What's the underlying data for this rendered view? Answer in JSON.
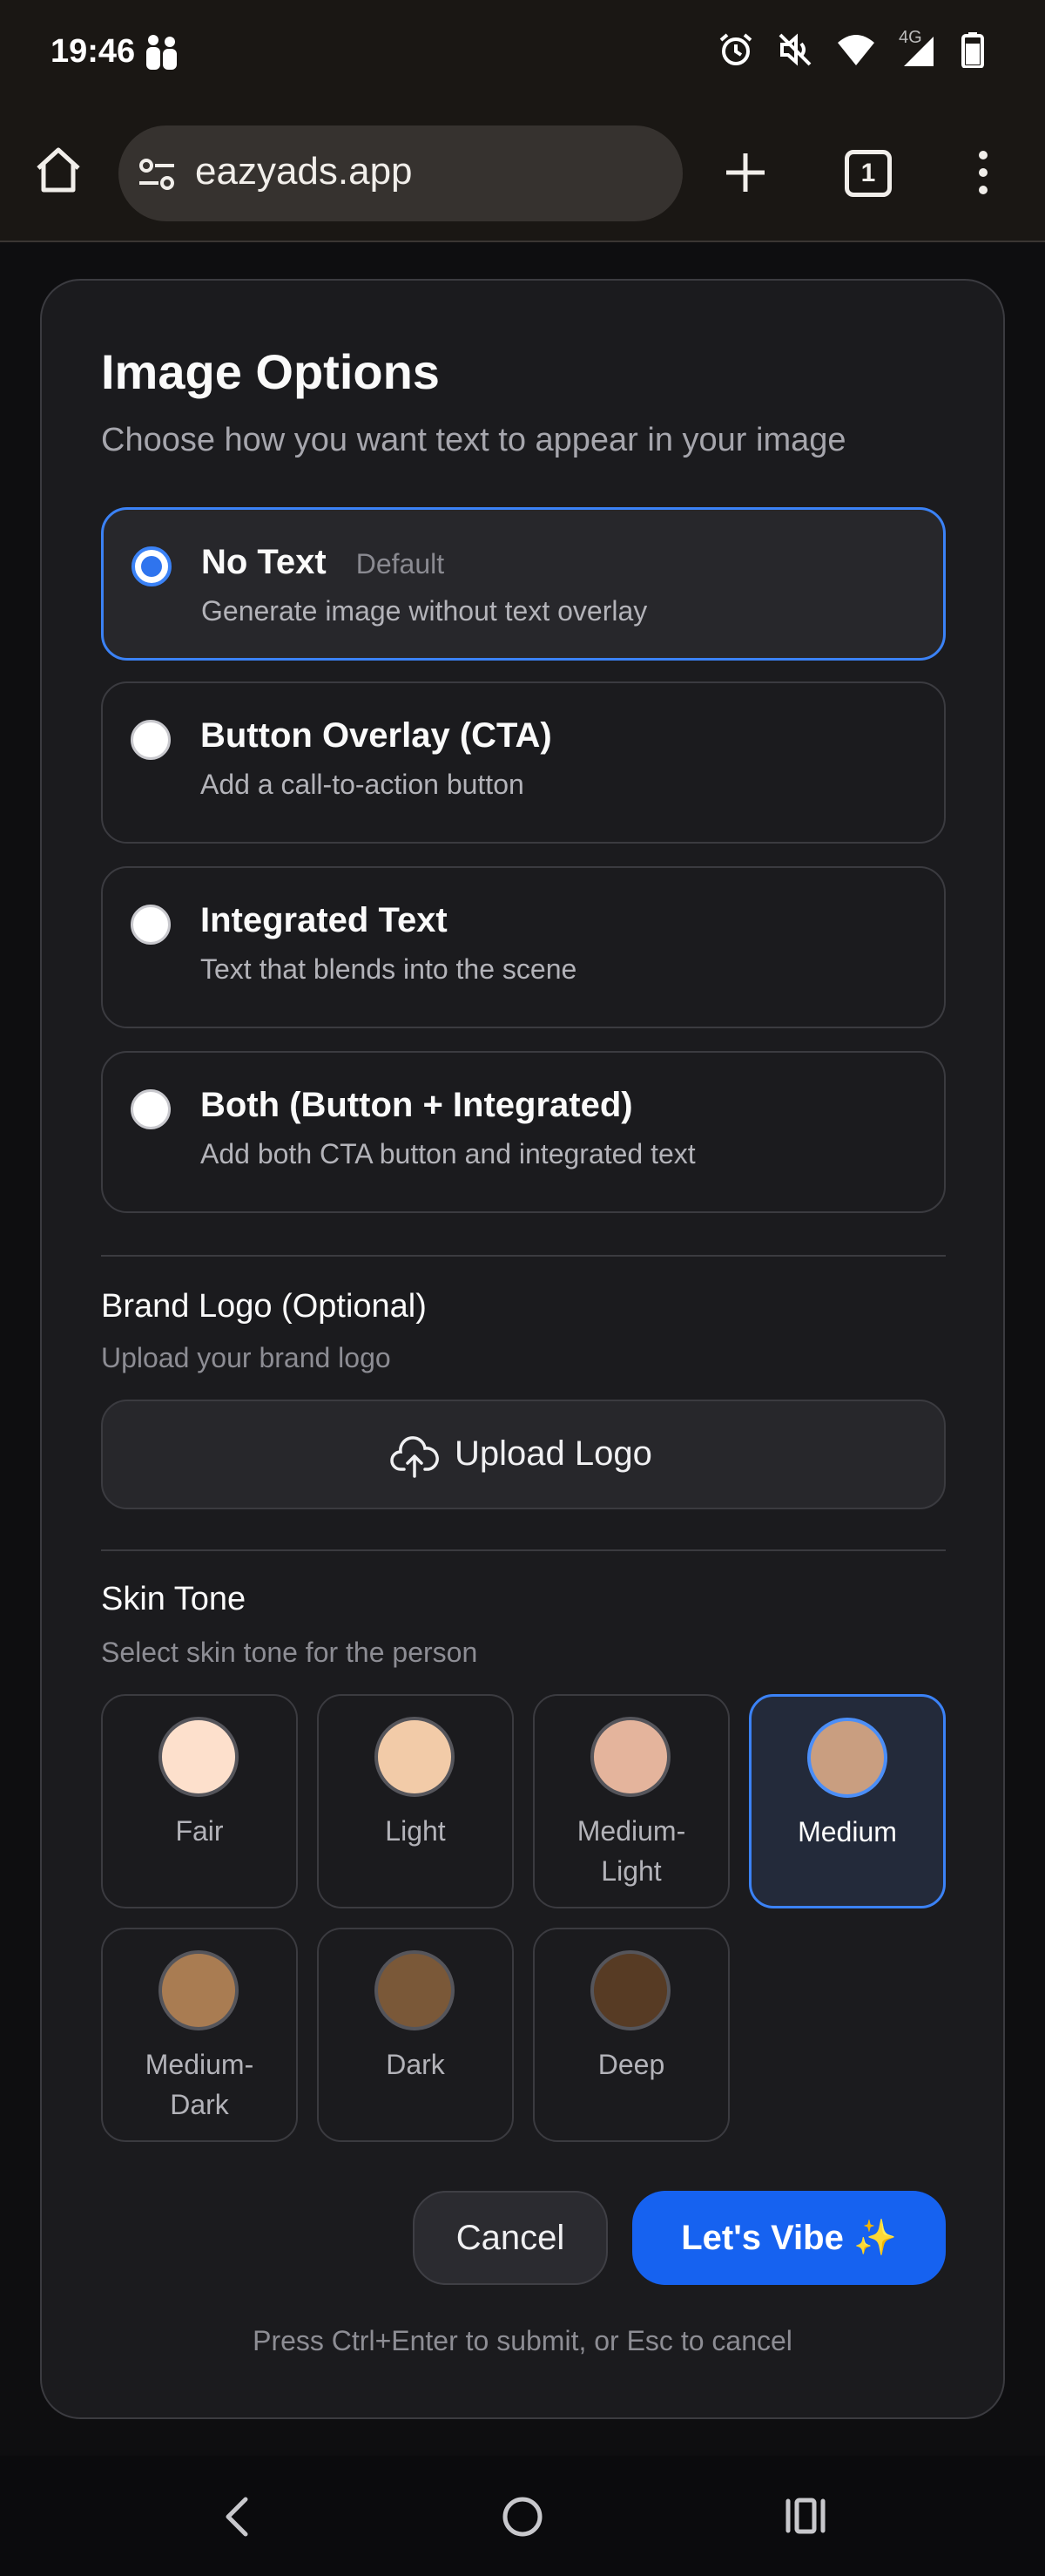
{
  "status": {
    "time": "19:46",
    "network": "4G"
  },
  "browser": {
    "url": "eazyads.app",
    "tab_count": "1"
  },
  "dialog": {
    "title": "Image Options",
    "subtitle": "Choose how you want text to appear in your image",
    "options": [
      {
        "title": "No Text",
        "badge": "Default",
        "desc": "Generate image without text overlay",
        "selected": true
      },
      {
        "title": "Button Overlay (CTA)",
        "desc": "Add a call-to-action button",
        "selected": false
      },
      {
        "title": "Integrated Text",
        "desc": "Text that blends into the scene",
        "selected": false
      },
      {
        "title": "Both (Button + Integrated)",
        "desc": "Add both CTA button and integrated text",
        "selected": false
      }
    ],
    "logo": {
      "title": "Brand Logo (Optional)",
      "subtitle": "Upload your brand logo",
      "button": "Upload Logo"
    },
    "skin": {
      "title": "Skin Tone",
      "subtitle": "Select skin tone for the person",
      "tones": [
        {
          "label": "Fair",
          "color": "#fde0cc"
        },
        {
          "label": "Light",
          "color": "#f2cba8"
        },
        {
          "label": "Medium-\nLight",
          "color": "#e4b49c"
        },
        {
          "label": "Medium",
          "color": "#c99e80",
          "selected": true
        },
        {
          "label": "Medium-\nDark",
          "color": "#a97c52"
        },
        {
          "label": "Dark",
          "color": "#7a5838"
        },
        {
          "label": "Deep",
          "color": "#573b24"
        }
      ]
    },
    "cancel": "Cancel",
    "submit": "Let's Vibe ✨",
    "hint": "Press Ctrl+Enter to submit, or Esc to cancel"
  },
  "colors": {
    "accent": "#3b82f6",
    "primary_button": "#1662f0",
    "dialog_bg": "#1b1b1e"
  }
}
